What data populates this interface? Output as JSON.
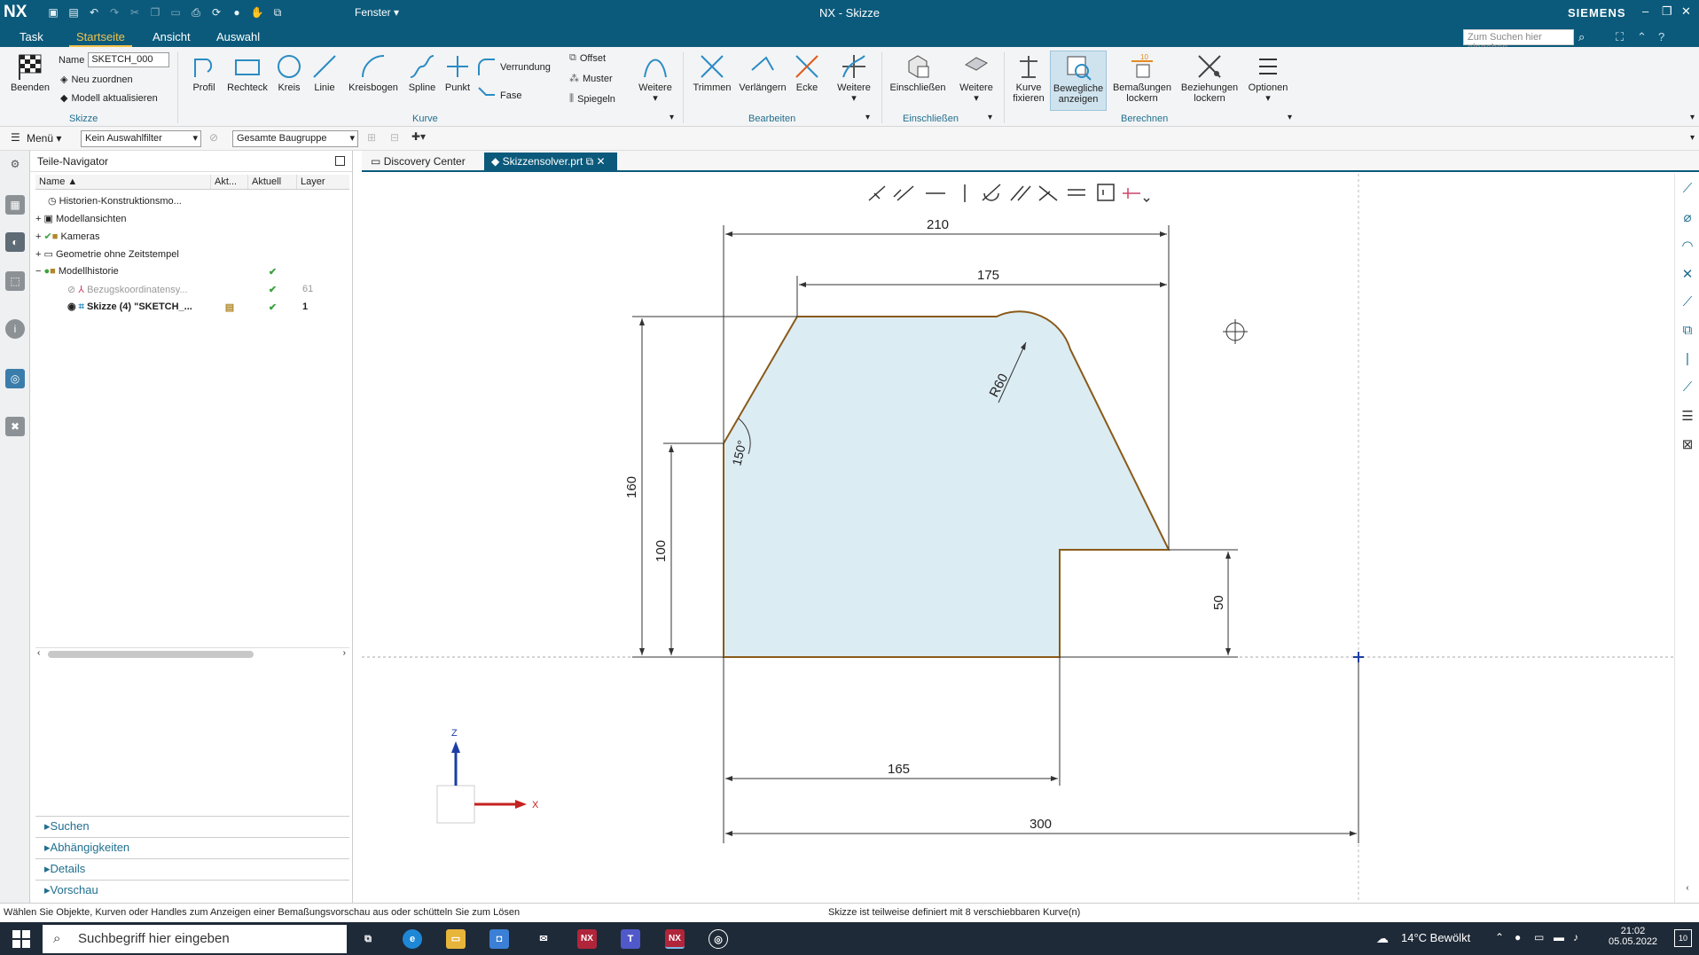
{
  "titlebar": {
    "logo": "NX",
    "title": "NX - Skizze",
    "brand": "SIEMENS",
    "fenster": "Fenster ▾"
  },
  "tabs": [
    {
      "label": "Task"
    },
    {
      "label": "Startseite"
    },
    {
      "label": "Ansicht"
    },
    {
      "label": "Auswahl"
    }
  ],
  "search": {
    "placeholder": "Zum Suchen hier eingeben"
  },
  "ribbon": {
    "beenden": "Beenden",
    "name_label": "Name",
    "name_value": "SKETCH_000",
    "neu_zuordnen": "Neu zuordnen",
    "modell_aktualisieren": "Modell aktualisieren",
    "groups": {
      "skizze": "Skizze",
      "kurve": "Kurve",
      "bearbeiten": "Bearbeiten",
      "einschliessen": "Einschließen",
      "berechnen": "Berechnen"
    },
    "kurve": {
      "profil": "Profil",
      "rechteck": "Rechteck",
      "kreis": "Kreis",
      "linie": "Linie",
      "kreisbogen": "Kreisbogen",
      "spline": "Spline",
      "punkt": "Punkt",
      "verrundung": "Verrundung",
      "fase": "Fase",
      "offset": "Offset",
      "muster": "Muster",
      "spiegeln": "Spiegeln",
      "weitere": "Weitere"
    },
    "bearbeiten": {
      "trimmen": "Trimmen",
      "verlaengern": "Verlängern",
      "ecke": "Ecke",
      "weitere": "Weitere"
    },
    "einschliessen": {
      "einschliessen": "Einschließen",
      "weitere": "Weitere"
    },
    "berechnen": {
      "kurve_fixieren_1": "Kurve",
      "kurve_fixieren_2": "fixieren",
      "bewegliche_1": "Bewegliche",
      "bewegliche_2": "anzeigen",
      "bemassungen_1": "Bemaßungen",
      "bemassungen_2": "lockern",
      "beziehungen_1": "Beziehungen",
      "beziehungen_2": "lockern",
      "optionen": "Optionen"
    }
  },
  "filterbar": {
    "menu": "Menü ▾",
    "filter": "Kein Auswahlfilter",
    "scope": "Gesamte Baugruppe"
  },
  "navigator": {
    "title": "Teile-Navigator",
    "columns": [
      "Name",
      "Akt...",
      "Aktuell",
      "Layer"
    ],
    "rows": [
      {
        "name": "Historien-Konstruktionsmo...",
        "ak": "",
        "au": "",
        "ly": ""
      },
      {
        "name": "Modellansichten",
        "ak": "",
        "au": "",
        "ly": ""
      },
      {
        "name": "Kameras",
        "ak": "",
        "au": "",
        "ly": ""
      },
      {
        "name": "Geometrie ohne Zeitstempel",
        "ak": "",
        "au": "",
        "ly": ""
      },
      {
        "name": "Modellhistorie",
        "ak": "",
        "au": "✔",
        "ly": ""
      },
      {
        "name": "Bezugskoordinatensy...",
        "ak": "",
        "au": "✔",
        "ly": "61"
      },
      {
        "name": "Skizze (4) \"SKETCH_...",
        "ak": "",
        "au": "✔",
        "ly": "1"
      }
    ],
    "sections": [
      "Suchen",
      "Abhängigkeiten",
      "Details",
      "Vorschau"
    ]
  },
  "doctabs": [
    {
      "label": "Discovery Center"
    },
    {
      "label": "Skizzensolver.prt"
    }
  ],
  "sketch": {
    "dims": {
      "d210": "210",
      "d175": "175",
      "r60": "R60",
      "a150": "150°",
      "d160": "160",
      "d100": "100",
      "d50": "50",
      "d165": "165",
      "d300": "300"
    },
    "axes": {
      "z": "Z",
      "x": "X"
    }
  },
  "status": {
    "left": "Wählen Sie Objekte, Kurven oder Handles zum Anzeigen einer Bemaßungsvorschau aus oder schütteln Sie zum Lösen",
    "right": "Skizze ist teilweise definiert mit 8 verschiebbaren Kurve(n)"
  },
  "taskbar": {
    "search": "Suchbegriff hier eingeben",
    "weather": "14°C Bewölkt",
    "time": "21:02",
    "date": "05.05.2022",
    "nx_label": "NX"
  },
  "colors": {
    "titlebar": "#0b5a7b",
    "accent_tab": "#f1c14b",
    "sketch_fill": "#dcecf3",
    "sketch_edge": "#8a5a18"
  }
}
